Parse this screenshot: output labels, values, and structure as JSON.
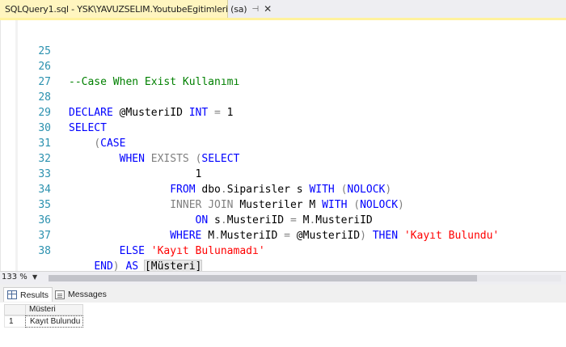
{
  "tab": {
    "title": "SQLQuery1.sql - YSK\\YAVUZSELIM.YoutubeEgitimleri (sa)",
    "pin_icon": "pin-icon",
    "close_icon": "close-icon"
  },
  "editor": {
    "lines": [
      {
        "num": "25",
        "text": ""
      },
      {
        "num": "26",
        "text": "--Case When Exist Kullanımı"
      },
      {
        "num": "27",
        "text": ""
      },
      {
        "num": "28",
        "text": "DECLARE @MusteriID INT = 1"
      },
      {
        "num": "29",
        "text": "SELECT"
      },
      {
        "num": "30",
        "text": "    (CASE"
      },
      {
        "num": "31",
        "text": "        WHEN EXISTS (SELECT"
      },
      {
        "num": "32",
        "text": "                    1"
      },
      {
        "num": "33",
        "text": "                FROM dbo.Siparisler s WITH (NOLOCK)"
      },
      {
        "num": "34",
        "text": "                INNER JOIN Musteriler M WITH (NOLOCK)"
      },
      {
        "num": "35",
        "text": "                    ON s.MusteriID = M.MusteriID"
      },
      {
        "num": "36",
        "text": "                WHERE M.MusteriID = @MusteriID) THEN 'Kayıt Bulundu'"
      },
      {
        "num": "37",
        "text": "        ELSE 'Kayıt Bulunamadı'"
      },
      {
        "num": "38",
        "text": "    END) AS [Müsteri]"
      }
    ]
  },
  "zoom": {
    "value": "133 %"
  },
  "results_tabs": [
    {
      "label": "Results",
      "icon": "grid-icon"
    },
    {
      "label": "Messages",
      "icon": "messages-icon"
    }
  ],
  "results": {
    "columns": [
      "Müsteri"
    ],
    "rows": [
      {
        "num": "1",
        "cells": [
          "Kayıt Bulundu"
        ]
      }
    ]
  },
  "colors": {
    "keyword": "#0000ff",
    "comment": "#008000",
    "string": "#ff0000",
    "operator": "#808080",
    "line_number": "#2b91af",
    "tab_active": "#fff5bf"
  }
}
